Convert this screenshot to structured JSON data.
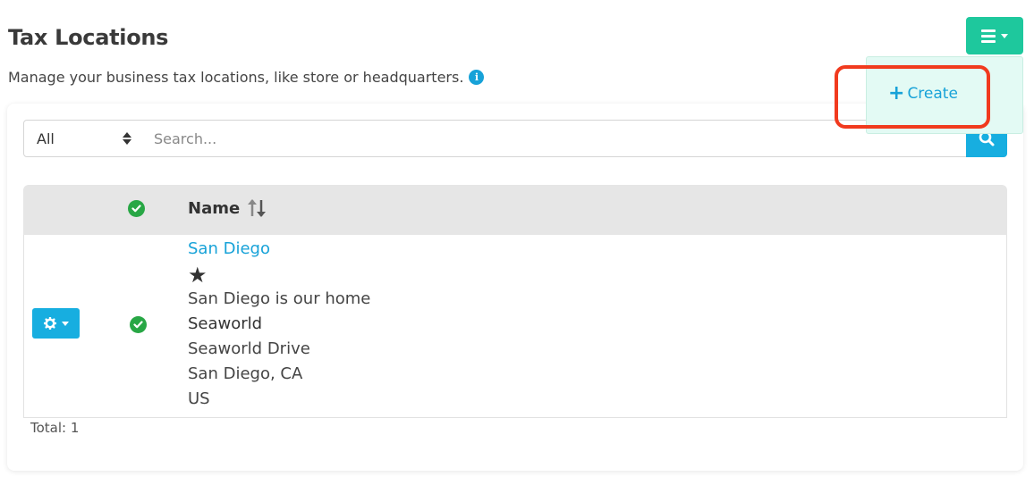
{
  "header": {
    "title": "Tax Locations",
    "subtitle": "Manage your business tax locations, like store or headquarters.",
    "info_icon": "i"
  },
  "toolbar": {
    "menu_button_icon": "hamburger-icon",
    "dropdown": {
      "create_label": "Create",
      "create_icon": "+"
    }
  },
  "filter": {
    "selected": "All",
    "search_placeholder": "Search..."
  },
  "table": {
    "columns": {
      "name": "Name"
    },
    "rows": [
      {
        "link": "San Diego",
        "star": "★",
        "description": "San Diego is our home",
        "place": "Seaworld",
        "street": "Seaworld Drive",
        "city": "San Diego, CA",
        "country": "US"
      }
    ]
  },
  "footer": {
    "total": "Total: 1"
  },
  "colors": {
    "accent_green": "#1ec89d",
    "accent_blue": "#17aee0",
    "link": "#17a2d8",
    "check": "#28a745",
    "highlight": "#f13a1e"
  }
}
